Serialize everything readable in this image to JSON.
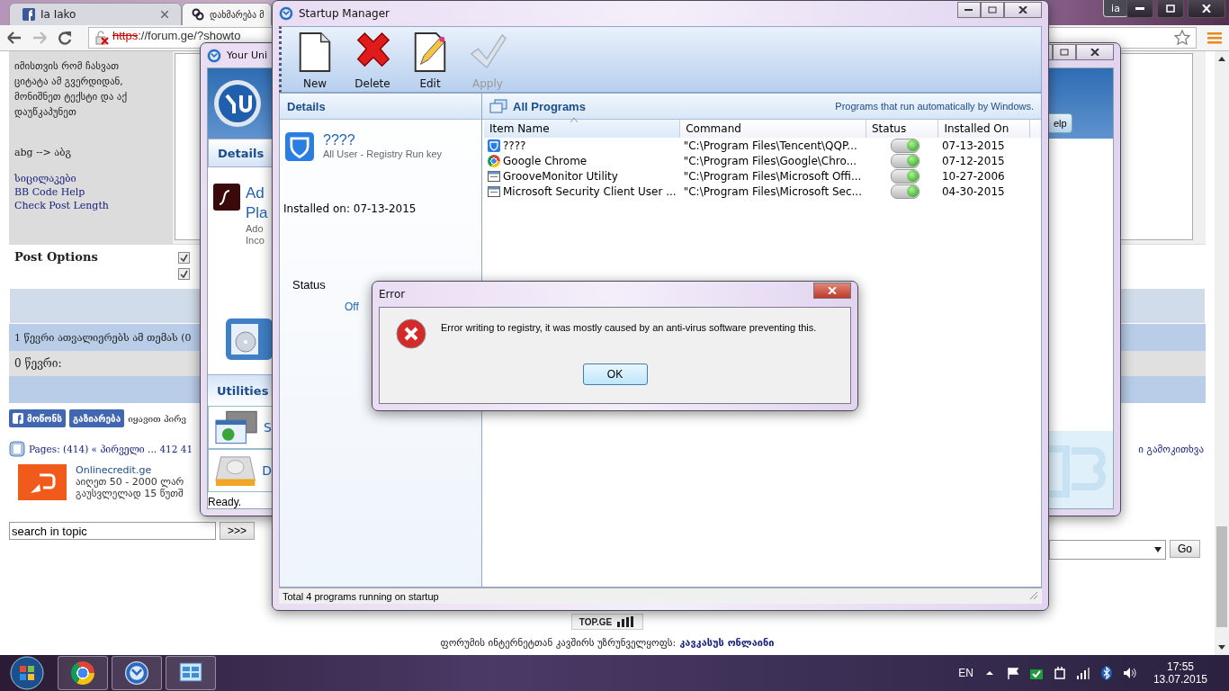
{
  "browser": {
    "tabs": [
      {
        "label": "Ia Iako",
        "kind": "facebook",
        "selected": false
      },
      {
        "label": "დახმარება მ",
        "kind": "forum",
        "selected": true
      }
    ],
    "profile": "ia",
    "scheme": "https",
    "address": "://forum.ge/?showto"
  },
  "page": {
    "hint": "იმისთვის რომ ჩასვათ ციტატა ამ გვერდიდან, მონიშნეთ ტექსტი და აქ დაუწკაპუნეთ",
    "example": "abg --> აბგ",
    "links": [
      "სიცილაკები",
      "BB Code Help",
      "Check Post Length"
    ],
    "post_options": {
      "label": "Post Options",
      "checkboxes": [
        {
          "checked": true
        },
        {
          "checked": true
        }
      ]
    },
    "viewers": "1 წევრი ათვალიერებს ამ თემას (0",
    "members": "0 წევრი:",
    "social": [
      "მოწონს",
      "გაზიარება"
    ],
    "social_note": "იყავით პირვ",
    "pages": "Pages: (414) « პირველი ... 412 41",
    "poll": "ი გამოკითხვა",
    "ad": {
      "title": "Onlinecredit.ge",
      "lines": [
        "აიღეთ 50 - 2000 ლარ",
        "გაუსვლელად 15 წუთშ"
      ]
    },
    "search": {
      "value": "search in topic",
      "button": ">>>"
    },
    "jump_button": "Go",
    "counter": "TOP.GE",
    "footer": {
      "text": "ფორუმის ინტერნეტთან კავშირს უზრუნველყოფს:",
      "link": "კავკასუს ონლაინი"
    }
  },
  "uninstaller": {
    "title": "Your Uni",
    "tab": "Details",
    "item_name": [
      "Ad",
      "Pla"
    ],
    "item_sub": [
      "Ado",
      "Inco"
    ],
    "section": "Utilities",
    "utilities": [
      {
        "label": "S",
        "kind": "window"
      },
      {
        "label": "D",
        "kind": "disk"
      }
    ],
    "status": "Ready.",
    "help_button": "elp"
  },
  "startup": {
    "title": "Startup Manager",
    "toolbar": [
      {
        "label": "New",
        "kind": "new",
        "disabled": false
      },
      {
        "label": "Delete",
        "kind": "delete",
        "disabled": false
      },
      {
        "label": "Edit",
        "kind": "edit",
        "disabled": false
      },
      {
        "label": "Apply",
        "kind": "apply",
        "disabled": true
      }
    ],
    "details": {
      "heading": "Details",
      "name": "????",
      "source": "All User - Registry Run key",
      "installed": "Installed on: 07-13-2015",
      "status_label": "Status",
      "off_label": "Off"
    },
    "list": {
      "heading": "All Programs",
      "note": "Programs that run automatically by Windows.",
      "columns": [
        {
          "label": "Item Name",
          "sorted": true
        },
        {
          "label": "Command",
          "sorted": false
        },
        {
          "label": "Status",
          "sorted": false
        },
        {
          "label": "Installed On",
          "sorted": false
        }
      ],
      "rows": [
        {
          "name": "????",
          "kind": "shield",
          "command": "\"C:\\Program Files\\Tencent\\QQP...",
          "on": true,
          "date": "07-13-2015"
        },
        {
          "name": "Google Chrome",
          "kind": "chrome",
          "command": "\"C:\\Program Files\\Google\\Chro...",
          "on": true,
          "date": "07-12-2015"
        },
        {
          "name": "GrooveMonitor Utility",
          "kind": "window",
          "command": "\"C:\\Program Files\\Microsoft Offi...",
          "on": true,
          "date": "10-27-2006"
        },
        {
          "name": "Microsoft Security Client User ...",
          "kind": "window",
          "command": "\"C:\\Program Files\\Microsoft Sec...",
          "on": true,
          "date": "04-30-2015"
        }
      ]
    },
    "status_bar": "Total 4 programs running on startup"
  },
  "error": {
    "title": "Error",
    "message": "Error writing to registry, it was mostly caused by an anti-virus software preventing this.",
    "button": "OK"
  },
  "taskbar": {
    "apps": [
      {
        "kind": "chrome"
      },
      {
        "kind": "uninstaller"
      },
      {
        "kind": "control"
      }
    ],
    "language": "EN",
    "time": "17:55",
    "date": "13.07.2015"
  }
}
